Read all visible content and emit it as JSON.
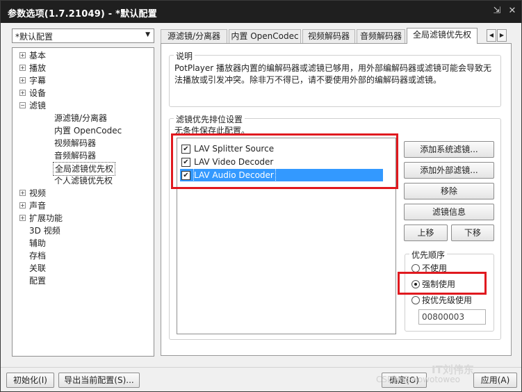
{
  "window": {
    "title": "参数选项(1.7.21049) - *默认配置",
    "pin_glyph": "⇲",
    "close_glyph": "✕"
  },
  "profile": {
    "value": "*默认配置"
  },
  "tree": {
    "items": [
      {
        "label": "基本",
        "expander": "+"
      },
      {
        "label": "播放",
        "expander": "+"
      },
      {
        "label": "字幕",
        "expander": "+"
      },
      {
        "label": "设备",
        "expander": "+"
      },
      {
        "label": "滤镜",
        "expander": "−"
      },
      {
        "label": "源滤镜/分离器"
      },
      {
        "label": "内置 OpenCodec"
      },
      {
        "label": "视频解码器"
      },
      {
        "label": "音频解码器"
      },
      {
        "label": "全局滤镜优先权",
        "selected": true
      },
      {
        "label": "个人滤镜优先权"
      },
      {
        "label": "视频",
        "expander": "+"
      },
      {
        "label": "声音",
        "expander": "+"
      },
      {
        "label": "扩展功能",
        "expander": "+"
      },
      {
        "label": "3D 视频"
      },
      {
        "label": "辅助"
      },
      {
        "label": "存档"
      },
      {
        "label": "关联"
      },
      {
        "label": "配置"
      }
    ]
  },
  "tabs": [
    {
      "label": "源滤镜/分离器"
    },
    {
      "label": "内置 OpenCodec"
    },
    {
      "label": "视频解码器"
    },
    {
      "label": "音频解码器"
    },
    {
      "label": "全局滤镜优先权",
      "active": true
    }
  ],
  "tab_scroll": {
    "left": "◀",
    "right": "▶"
  },
  "description": {
    "title": "说明",
    "text": "PotPlayer 播放器内置的编解码器或滤镜已够用，用外部编解码器或滤镜可能会导致无法播放或引发冲突。除非万不得已，请不要使用外部的编解码器或滤镜。"
  },
  "priority": {
    "title": "滤镜优先排位设置",
    "subtitle": "无条件保存此配置。",
    "filters": [
      {
        "label": "LAV Splitter Source",
        "checked": true
      },
      {
        "label": "LAV Video Decoder",
        "checked": true
      },
      {
        "label": "LAV Audio Decoder",
        "checked": true,
        "selected": true
      }
    ],
    "check_glyph": "✔",
    "buttons": {
      "add_system": "添加系统滤镜...",
      "add_external": "添加外部滤镜...",
      "remove": "移除",
      "info": "滤镜信息",
      "up": "上移",
      "down": "下移"
    }
  },
  "order": {
    "title": "优先顺序",
    "options": [
      {
        "label": "不使用",
        "selected": false
      },
      {
        "label": "强制使用",
        "selected": true
      },
      {
        "label": "按优先级使用",
        "selected": false
      }
    ],
    "priority_value": "00800003"
  },
  "footer": {
    "init_label": "初始化(I)",
    "export_label": "导出当前配置(S)...",
    "ok_label": "确定(O)",
    "apply_label": "应用(A)"
  },
  "watermark": {
    "main": "IT刘伟东",
    "sub": "CSDN @wowotoweo"
  },
  "colors": {
    "highlight": "#e0191f",
    "selection": "#3399ff",
    "titlebar": "#1f1f1f"
  }
}
